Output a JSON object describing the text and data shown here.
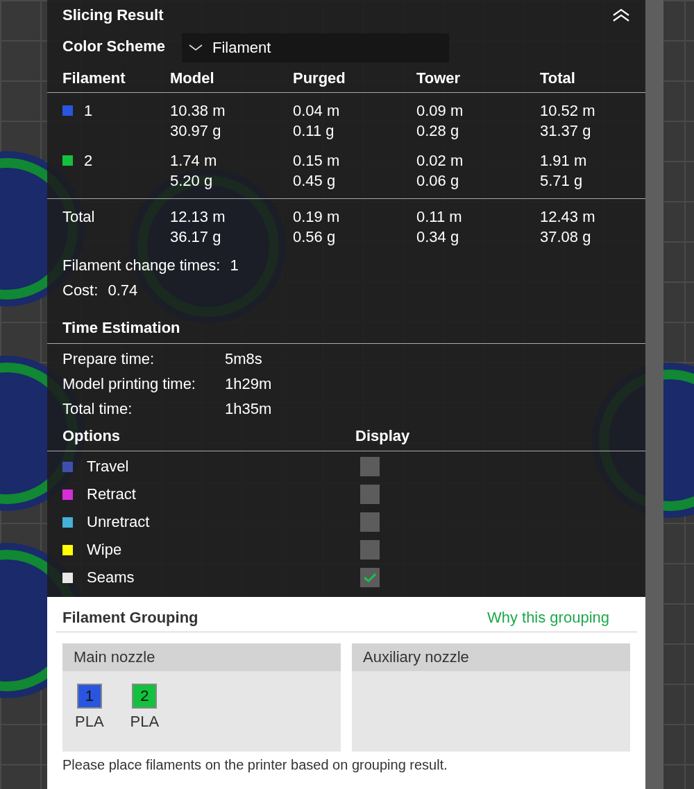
{
  "panel": {
    "title": "Slicing Result"
  },
  "color_scheme": {
    "label": "Color Scheme",
    "value": "Filament"
  },
  "filament_table": {
    "columns": [
      "Filament",
      "Model",
      "Purged",
      "Tower",
      "Total"
    ],
    "rows": [
      {
        "color": "#2a55e0",
        "cells": [
          [
            "1"
          ],
          [
            "10.38 m",
            "30.97 g"
          ],
          [
            "0.04 m",
            "0.11 g"
          ],
          [
            "0.09 m",
            "0.28 g"
          ],
          [
            "10.52 m",
            "31.37 g"
          ]
        ]
      },
      {
        "color": "#12c23e",
        "cells": [
          [
            "2"
          ],
          [
            "1.74 m",
            "5.20 g"
          ],
          [
            "0.15 m",
            "0.45 g"
          ],
          [
            "0.02 m",
            "0.06 g"
          ],
          [
            "1.91 m",
            "5.71 g"
          ]
        ]
      }
    ],
    "total": {
      "cells": [
        [
          "Total"
        ],
        [
          "12.13 m",
          "36.17 g"
        ],
        [
          "0.19 m",
          "0.56 g"
        ],
        [
          "0.11 m",
          "0.34 g"
        ],
        [
          "12.43 m",
          "37.08 g"
        ]
      ]
    }
  },
  "summary": [
    {
      "label": "Filament change times:",
      "value": "1"
    },
    {
      "label": "Cost:",
      "value": "0.74"
    }
  ],
  "time_estimation": {
    "title": "Time Estimation",
    "rows": [
      {
        "label": "Prepare time:",
        "value": "5m8s"
      },
      {
        "label": "Model printing time:",
        "value": "1h29m"
      },
      {
        "label": "Total time:",
        "value": "1h35m"
      }
    ]
  },
  "options": {
    "columns": [
      "Options",
      "Display"
    ],
    "items": [
      {
        "name": "Travel",
        "color": "#3f4fb0",
        "checked": false
      },
      {
        "name": "Retract",
        "color": "#d62ed6",
        "checked": false
      },
      {
        "name": "Unretract",
        "color": "#45b0d8",
        "checked": false
      },
      {
        "name": "Wipe",
        "color": "#ffff00",
        "checked": false
      },
      {
        "name": "Seams",
        "color": "#e8e8e8",
        "checked": true
      }
    ]
  },
  "grouping": {
    "title": "Filament Grouping",
    "link": "Why this grouping",
    "nozzles": [
      {
        "title": "Main nozzle",
        "filaments": [
          {
            "number": "1",
            "type": "PLA",
            "color": "#2a55e0"
          },
          {
            "number": "2",
            "type": "PLA",
            "color": "#12c23e"
          }
        ]
      },
      {
        "title": "Auxiliary nozzle"
      }
    ],
    "note": "Please place filaments on the printer based on grouping result."
  }
}
